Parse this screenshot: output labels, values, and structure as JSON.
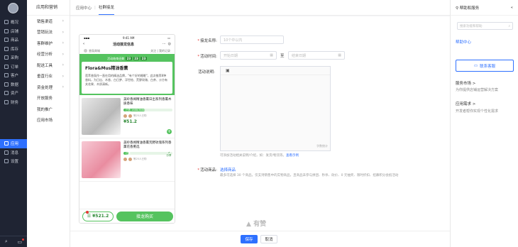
{
  "nav1": {
    "items": [
      {
        "label": "概况",
        "icon": "overview-icon"
      },
      {
        "label": "店铺",
        "icon": "store-icon"
      },
      {
        "label": "商品",
        "icon": "goods-icon"
      },
      {
        "label": "库存",
        "icon": "inventory-icon"
      },
      {
        "label": "采购",
        "icon": "purchase-icon"
      },
      {
        "label": "订单",
        "icon": "order-icon"
      },
      {
        "label": "客户",
        "icon": "customer-icon"
      },
      {
        "label": "数据",
        "icon": "data-icon"
      },
      {
        "label": "资产",
        "icon": "asset-icon"
      },
      {
        "label": "财务",
        "icon": "finance-icon"
      }
    ],
    "active": {
      "label": "应用",
      "icon": "apps-icon"
    },
    "lower": [
      {
        "label": "消息",
        "icon": "message-icon"
      },
      {
        "label": "设置",
        "icon": "settings-icon"
      }
    ]
  },
  "nav2": {
    "title": "应用和营销",
    "items": [
      {
        "label": "销售渠道",
        "arrow": true
      },
      {
        "label": "营销玩法",
        "arrow": true
      },
      {
        "label": "客群维护",
        "arrow": true
      },
      {
        "label": "经营分析",
        "arrow": true
      },
      {
        "label": "配送工具",
        "arrow": true
      },
      {
        "label": "垂直行业",
        "arrow": true
      },
      {
        "label": "资金处理",
        "arrow": true
      },
      {
        "label": "开放服务",
        "arrow": false
      },
      {
        "label": "我的推广",
        "arrow": false
      },
      {
        "label": "应用市场",
        "arrow": false
      }
    ]
  },
  "breadcrumb": {
    "parent": "应用中心",
    "separator": "|",
    "current": "社群接龙"
  },
  "phone": {
    "time": "9:41 AM",
    "nav_title": "活动接龙信息",
    "follow": "关注",
    "my_records": "我的记录",
    "organizer": "香氛商城",
    "countdown_label": "活动结束还剩",
    "countdown": [
      "23",
      "23",
      "23"
    ],
    "card_title": "Flora&Mus精油香薰",
    "card_desc": "莲萃香氛作一直在用的精油品牌，\"有个好的睡眠\"，此次推荐8种香料，为日出、木香、白日梦、浮世绘、荒野玫瑰、白茶、沙方有关花果、木质清新。",
    "products": [
      {
        "name": "美岭香闻精油香薰日出系列香薰木质香味",
        "progress_label": "已售 1688/3888",
        "progress": 0.43,
        "buyers": "等25人已购",
        "price": "¥51.2",
        "variant": "p1"
      },
      {
        "name": "美岭香闻精油香薰荒野玫瑰系列香薰花香熏选",
        "progress_label": "已售",
        "progress": 0.1,
        "buyers": "等25人已购",
        "price": "¥51.2",
        "share": "分享",
        "variant": "p2"
      }
    ],
    "cart_total": "¥521.2",
    "cart_badge": "1",
    "buy_button": "接龙购买"
  },
  "form": {
    "name_label": "接龙名称:",
    "name_placeholder": "10个中以内",
    "time_label": "活动时间:",
    "start_placeholder": "开始日期",
    "to": "至",
    "end_placeholder": "结束日期",
    "desc_label": "活动说明:",
    "desc_counter": "字数统计",
    "desc_hint": "可添加活动相关说明/介绍，如：发货/物流等。",
    "desc_example_link": "查看示例",
    "goods_label": "活动商品:",
    "goods_link": "选择商品",
    "goods_hint": "最多可选择 30 个商品，仅支持销售中的实物商品，且商品未参与拼团、秒杀、砍价、0 元抽奖、限时折扣、招募积分会抵活动"
  },
  "watermark": "有赞",
  "footer": {
    "save": "保存",
    "cancel": "取消"
  },
  "right": {
    "title": "帮助和服务",
    "search_placeholder": "搜索功能和帮助",
    "help_center": "帮助中心",
    "support_button": "联系客服",
    "market_title": "服务市场 >",
    "market_desc": "为你提供店铺运营解决方案",
    "demand_title": "应用需求 >",
    "demand_desc": "开发者帮你实现个性化需求"
  },
  "colors": {
    "primary": "#2e70ff",
    "green": "#55c35f",
    "sidebar": "#1f2433"
  }
}
